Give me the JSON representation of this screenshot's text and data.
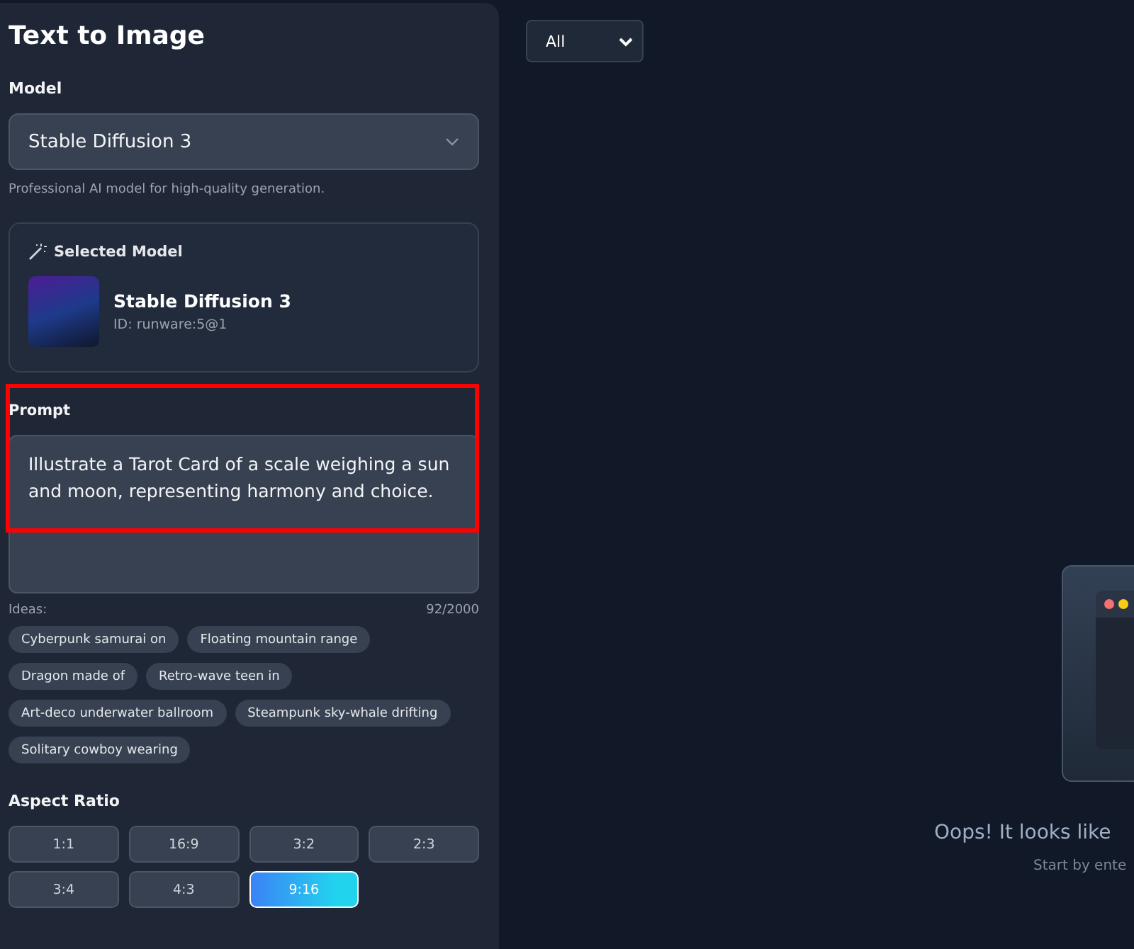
{
  "panel": {
    "title": "Text to Image"
  },
  "model": {
    "label": "Model",
    "value": "Stable Diffusion 3",
    "hint": "Professional AI model for high-quality generation."
  },
  "selected_model": {
    "heading": "Selected Model",
    "name": "Stable Diffusion 3",
    "id": "ID: runware:5@1"
  },
  "prompt": {
    "label": "Prompt",
    "value": "Illustrate a Tarot Card of a scale weighing a sun and moon, representing harmony and choice.",
    "highlighted": true,
    "ideas_label": "Ideas:",
    "count": "92/2000"
  },
  "ideas": [
    "Cyberpunk samurai on",
    "Floating mountain range",
    "Dragon made of",
    "Retro-wave teen in",
    "Art-deco underwater ballroom",
    "Steampunk sky-whale drifting",
    "Solitary cowboy wearing"
  ],
  "aspect_ratio": {
    "label": "Aspect Ratio",
    "options": [
      {
        "label": "1:1",
        "selected": false
      },
      {
        "label": "16:9",
        "selected": false
      },
      {
        "label": "3:2",
        "selected": false
      },
      {
        "label": "2:3",
        "selected": false
      },
      {
        "label": "3:4",
        "selected": false
      },
      {
        "label": "4:3",
        "selected": false
      },
      {
        "label": "9:16",
        "selected": true
      }
    ]
  },
  "gallery": {
    "filter": "All",
    "empty_title": "Oops! It looks like",
    "empty_hint": "Start by ente"
  }
}
